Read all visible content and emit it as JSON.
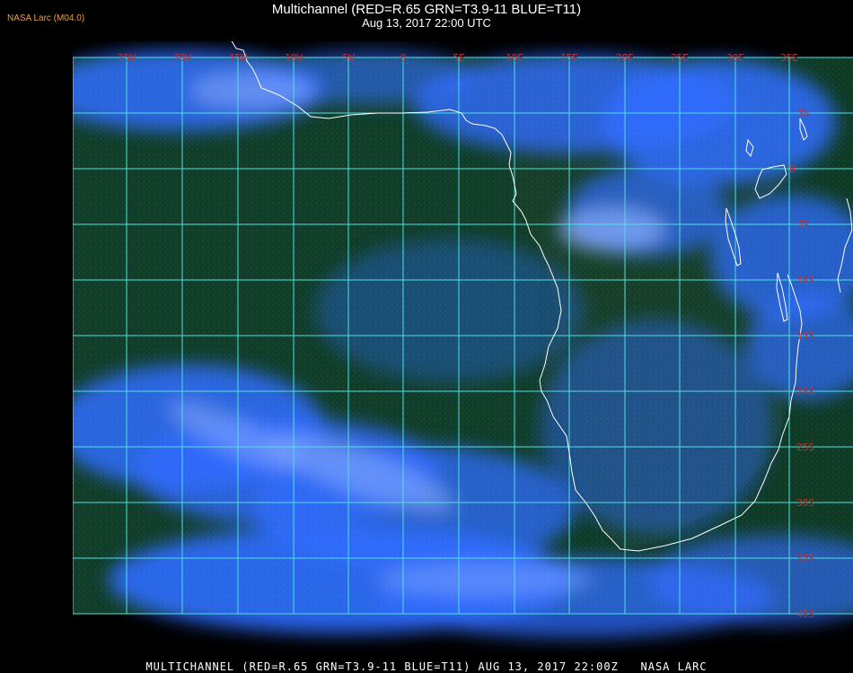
{
  "header": {
    "brand": "NASA Larc (M04.0)",
    "title": "Multichannel (RED=R.65 GRN=T3.9-11 BLUE=T11)",
    "datetime": "Aug 13, 2017 22:00 UTC"
  },
  "footer": {
    "caption": "MULTICHANNEL (RED=R.65 GRN=T3.9-11 BLUE=T11) AUG 13, 2017 22:00Z   NASA LARC"
  },
  "map": {
    "longitude_labels": [
      "25W",
      "20W",
      "15W",
      "10W",
      "5W",
      "0",
      "5E",
      "10E",
      "15E",
      "20E",
      "25E",
      "30E",
      "35E"
    ],
    "latitude_labels": [
      "5N",
      "0",
      "5S",
      "10S",
      "15S",
      "20S",
      "25S",
      "30S",
      "35S",
      "40S"
    ],
    "colors": {
      "gridline": "#4fe0e0",
      "grid_label": "#c83030",
      "coastline": "#ffffff",
      "ocean_dark": "#0f3a22",
      "cloud_blue": "#2f6cff",
      "cloud_bright": "#8fb0ff"
    }
  }
}
